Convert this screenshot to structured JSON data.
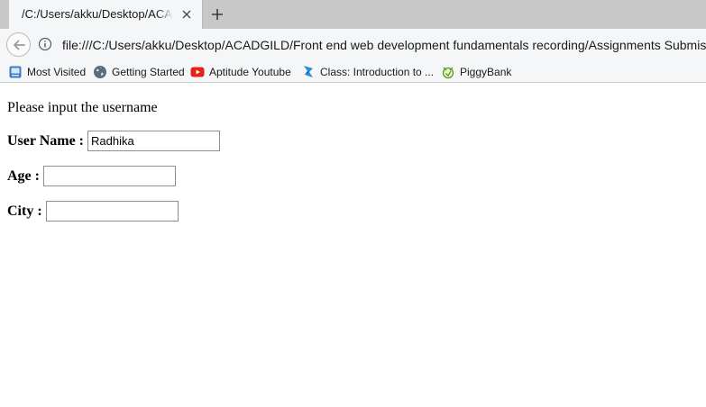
{
  "tab": {
    "title": "/C:/Users/akku/Desktop/ACADGILD",
    "close_icon": "close-icon",
    "new_tab_icon": "plus-icon"
  },
  "navbar": {
    "url": "file:///C:/Users/akku/Desktop/ACADGILD/Front end web development fundamentals recording/Assignments Submission",
    "back_icon": "back-arrow-icon",
    "info_icon": "info-icon"
  },
  "bookmarks": [
    {
      "label": "Most Visited",
      "icon": "most-visited-icon"
    },
    {
      "label": "Getting Started",
      "icon": "globe-icon"
    },
    {
      "label": "Aptitude Youtube",
      "icon": "youtube-icon"
    },
    {
      "label": "Class: Introduction to ...",
      "icon": "class-icon"
    },
    {
      "label": "PiggyBank",
      "icon": "piggybank-icon"
    }
  ],
  "page": {
    "prompt": "Please input the username",
    "fields": {
      "username": {
        "label": "User Name :",
        "value": "Radhika"
      },
      "age": {
        "label": "Age :",
        "value": ""
      },
      "city": {
        "label": "City :",
        "value": ""
      }
    }
  },
  "colors": {
    "tabstrip": "#c8c8c8",
    "toolbar": "#f5f6f7",
    "field_border": "#8f8f8f",
    "youtube_red": "#e62117"
  }
}
